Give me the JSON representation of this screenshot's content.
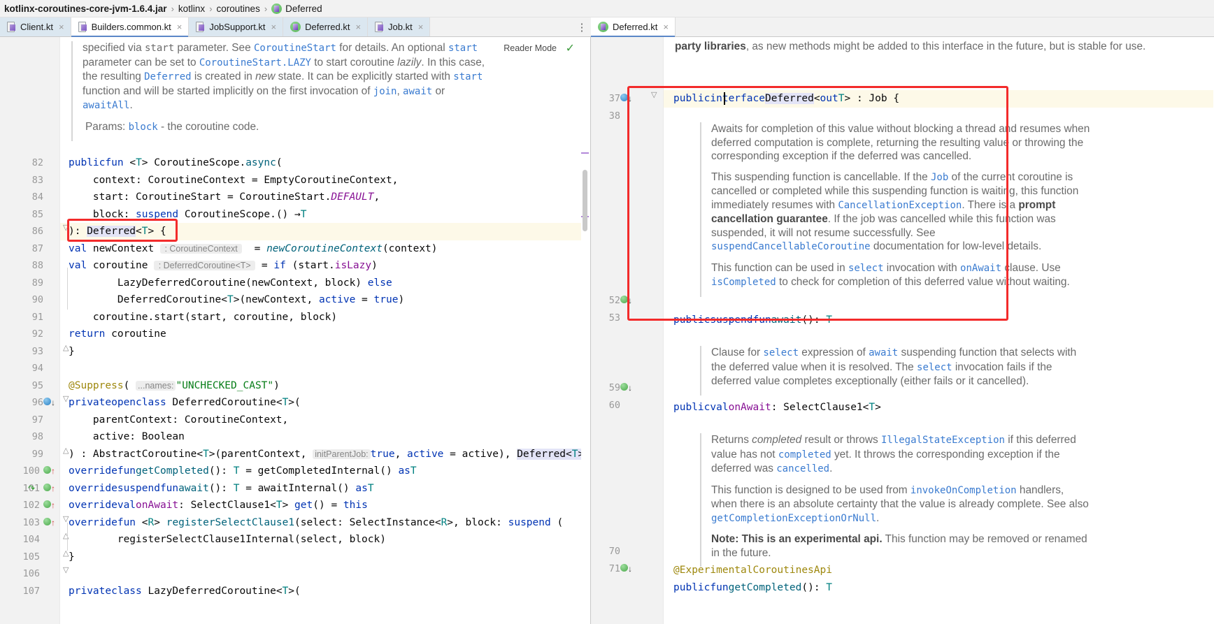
{
  "breadcrumb": {
    "items": [
      {
        "label": "kotlinx-coroutines-core-jvm-1.6.4.jar",
        "icon": "jar-icon"
      },
      {
        "label": "kotlinx",
        "icon": "package-icon"
      },
      {
        "label": "coroutines",
        "icon": "package-icon"
      },
      {
        "label": "Deferred",
        "icon": "kotlin-interface-icon"
      }
    ],
    "separator": "›"
  },
  "left_pane": {
    "tabs": [
      {
        "label": "Client.kt",
        "icon": "kotlin-file-icon",
        "active": false
      },
      {
        "label": "Builders.common.kt",
        "icon": "kotlin-file-icon",
        "active": true
      },
      {
        "label": "JobSupport.kt",
        "icon": "kotlin-file-icon",
        "active": false
      },
      {
        "label": "Deferred.kt",
        "icon": "kotlin-interface-icon",
        "active": false
      },
      {
        "label": "Job.kt",
        "icon": "kotlin-file-icon",
        "active": false
      }
    ],
    "close_glyph": "×",
    "overflow_glyph": "⋮",
    "reader_mode_label": "Reader Mode",
    "reader_mode_check": "✓",
    "doc_paragraphs": [
      "specified via start parameter. See CoroutineStart for details. An optional start parameter can be set to CoroutineStart.LAZY to start coroutine lazily. In this case, the resulting Deferred is created in new state. It can be explicitly started with start function and will be started implicitly on the first invocation of join, await or awaitAll.",
      "Params: block - the coroutine code."
    ],
    "lines": [
      {
        "n": "82",
        "text": "public fun <T> CoroutineScope.async("
      },
      {
        "n": "83",
        "text": "    context: CoroutineContext = EmptyCoroutineContext,"
      },
      {
        "n": "84",
        "text": "    start: CoroutineStart = CoroutineStart.DEFAULT,"
      },
      {
        "n": "85",
        "text": "    block: suspend CoroutineScope.() → T"
      },
      {
        "n": "86",
        "text": "): Deferred<T> {"
      },
      {
        "n": "87",
        "text": "    val newContext : CoroutineContext  = newCoroutineContext(context)"
      },
      {
        "n": "88",
        "text": "    val coroutine : DeferredCoroutine<T>  = if (start.isLazy)"
      },
      {
        "n": "89",
        "text": "        LazyDeferredCoroutine(newContext, block) else"
      },
      {
        "n": "90",
        "text": "        DeferredCoroutine<T>(newContext, active = true)"
      },
      {
        "n": "91",
        "text": "    coroutine.start(start, coroutine, block)"
      },
      {
        "n": "92",
        "text": "    return coroutine"
      },
      {
        "n": "93",
        "text": "}"
      },
      {
        "n": "94",
        "text": ""
      },
      {
        "n": "95",
        "text": "@Suppress( ...names: \"UNCHECKED_CAST\")"
      },
      {
        "n": "96",
        "text": "private open class DeferredCoroutine<T>("
      },
      {
        "n": "97",
        "text": "    parentContext: CoroutineContext,"
      },
      {
        "n": "98",
        "text": "    active: Boolean"
      },
      {
        "n": "99",
        "text": ") : AbstractCoroutine<T>(parentContext, initParentJob: true, active = active), Deferred<T>"
      },
      {
        "n": "100",
        "text": "    override fun getCompleted(): T = getCompletedInternal() as T"
      },
      {
        "n": "101",
        "text": "    override suspend fun await(): T = awaitInternal() as T"
      },
      {
        "n": "102",
        "text": "    override val onAwait: SelectClause1<T> get() = this"
      },
      {
        "n": "103",
        "text": "    override fun <R> registerSelectClause1(select: SelectInstance<R>, block: suspend ("
      },
      {
        "n": "104",
        "text": "        registerSelectClause1Internal(select, block)"
      },
      {
        "n": "105",
        "text": "}"
      },
      {
        "n": "106",
        "text": ""
      },
      {
        "n": "107",
        "text": "private class LazyDeferredCoroutine<T>("
      }
    ]
  },
  "right_pane": {
    "tab": {
      "label": "Deferred.kt",
      "icon": "kotlin-interface-icon",
      "close_glyph": "×"
    },
    "doc_top": "party libraries, as new methods might be added to this interface in the future, but is stable for use.",
    "lines": [
      {
        "n": "37",
        "text": "public interface Deferred<out T> : Job {"
      },
      {
        "n": "38",
        "text": ""
      },
      {
        "n": "52",
        "text": "    public suspend fun await(): T"
      },
      {
        "n": "53",
        "text": ""
      },
      {
        "n": "59",
        "text": "    public val onAwait: SelectClause1<T>"
      },
      {
        "n": "60",
        "text": ""
      },
      {
        "n": "70",
        "text": "    @ExperimentalCoroutinesApi"
      },
      {
        "n": "71",
        "text": "    public fun getCompleted(): T"
      }
    ],
    "doc_await": [
      "Awaits for completion of this value without blocking a thread and resumes when deferred computation is complete, returning the resulting value or throwing the corresponding exception if the deferred was cancelled.",
      "This suspending function is cancellable. If the Job of the current coroutine is cancelled or completed while this suspending function is waiting, this function immediately resumes with CancellationException. There is a prompt cancellation guarantee. If the job was cancelled while this function was suspended, it will not resume successfully. See suspendCancellableCoroutine documentation for low-level details.",
      "This function can be used in select invocation with onAwait clause. Use isCompleted to check for completion of this deferred value without waiting."
    ],
    "doc_onawait": [
      "Clause for select expression of await suspending function that selects with the deferred value when it is resolved. The select invocation fails if the deferred value completes exceptionally (either fails or it cancelled)."
    ],
    "doc_getcompleted": [
      "Returns completed result or throws IllegalStateException if this deferred value has not completed yet. It throws the corresponding exception if the deferred was cancelled.",
      "This function is designed to be used from invokeOnCompletion handlers, when there is an absolute certainty that the value is already complete. See also getCompletionExceptionOrNull.",
      "Note: This is an experimental api. This function may be removed or renamed in the future."
    ]
  },
  "annotations": {
    "highlight_color": "#f32b2b",
    "boxes": [
      {
        "name": "deferred-return-type-highlight"
      },
      {
        "name": "deferred-interface-body-highlight"
      }
    ]
  }
}
